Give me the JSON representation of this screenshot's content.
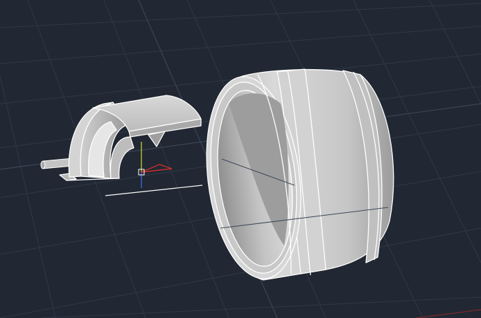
{
  "viewport": {
    "background_color": "#212833",
    "grid_color": "#2f3947",
    "grid_major_color": "#394556",
    "model_fill": "#c9c9c9",
    "model_shade": "#9d9d9d",
    "model_dark": "#8a8a8a",
    "edge_color": "#ffffff",
    "ucs_x_color": "#c9302c",
    "ucs_y_color": "#b9c431",
    "ucs_z_color": "#3b64d8"
  },
  "objects": [
    {
      "name": "bracket-part",
      "shape": "arched-shell"
    },
    {
      "name": "pin-part",
      "shape": "cylinder"
    },
    {
      "name": "ring-part",
      "shape": "hollow-cylinder"
    }
  ],
  "ucs_icon": "ucs-axis-icon"
}
